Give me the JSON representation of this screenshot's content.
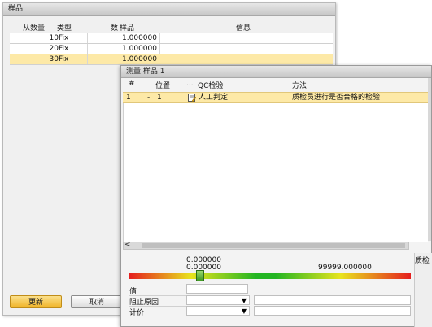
{
  "back_window": {
    "title": "样品",
    "columns": {
      "from_qty": "从数量",
      "type": "类型",
      "count": "数",
      "sample": "样品",
      "info": "信息"
    },
    "rows": [
      {
        "from_qty": "10",
        "type": "Fix",
        "sample": "1.000000"
      },
      {
        "from_qty": "20",
        "type": "Fix",
        "sample": "1.000000"
      },
      {
        "from_qty": "30",
        "type": "Fix",
        "sample": "1.000000"
      }
    ],
    "buttons": {
      "update": "更新",
      "cancel": "取消"
    }
  },
  "front_window": {
    "title": "测量 样品 1",
    "columns": {
      "num": "#",
      "position": "位置",
      "ellipsis": "...",
      "qc_check": "QC检验",
      "method": "方法"
    },
    "row": {
      "num": "1",
      "dash": "-",
      "position": "1",
      "qc_check": "人工判定",
      "method": "质检员进行是否合格的检验"
    },
    "scroll_arrow": "<",
    "meter": {
      "value_top": "0.000000",
      "min": "0.000000",
      "max": "99999.000000",
      "level": 0.25
    },
    "side_label": "质检",
    "fields": {
      "value_label": "值",
      "stop_reason_label": "阻止原因",
      "pricing_label": "计价"
    },
    "dropdown_arrow": "▼"
  }
}
